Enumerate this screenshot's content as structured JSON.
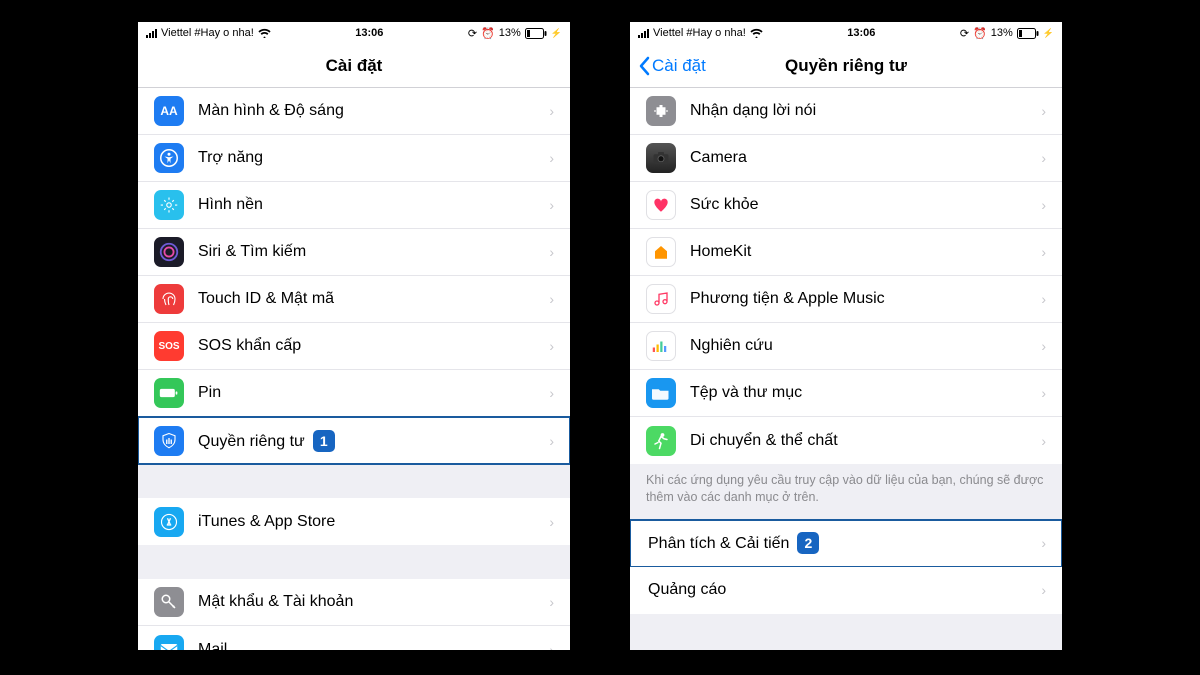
{
  "status": {
    "carrier": "Viettel #Hay o nha!",
    "time": "13:06",
    "battery": "13%"
  },
  "left": {
    "title": "Cài đặt",
    "rows": [
      {
        "label": "Màn hình & Độ sáng"
      },
      {
        "label": "Trợ năng"
      },
      {
        "label": "Hình nền"
      },
      {
        "label": "Siri & Tìm kiếm"
      },
      {
        "label": "Touch ID & Mật mã"
      },
      {
        "label": "SOS khẩn cấp"
      },
      {
        "label": "Pin"
      },
      {
        "label": "Quyền riêng tư",
        "step": "1"
      }
    ],
    "rows2": [
      {
        "label": "iTunes & App Store"
      }
    ],
    "rows3": [
      {
        "label": "Mật khẩu & Tài khoản"
      },
      {
        "label": "Mail"
      }
    ]
  },
  "right": {
    "back": "Cài đặt",
    "title": "Quyền riêng tư",
    "rows": [
      {
        "label": "Nhận dạng lời nói"
      },
      {
        "label": "Camera"
      },
      {
        "label": "Sức khỏe"
      },
      {
        "label": "HomeKit"
      },
      {
        "label": "Phương tiện & Apple Music"
      },
      {
        "label": "Nghiên cứu"
      },
      {
        "label": "Tệp và thư mục"
      },
      {
        "label": "Di chuyển & thể chất"
      }
    ],
    "footer": "Khi các ứng dụng yêu cầu truy cập vào dữ liệu của bạn, chúng sẽ được thêm vào các danh mục ở trên.",
    "rows2": [
      {
        "label": "Phân tích & Cải tiến",
        "step": "2"
      },
      {
        "label": "Quảng cáo"
      }
    ]
  }
}
